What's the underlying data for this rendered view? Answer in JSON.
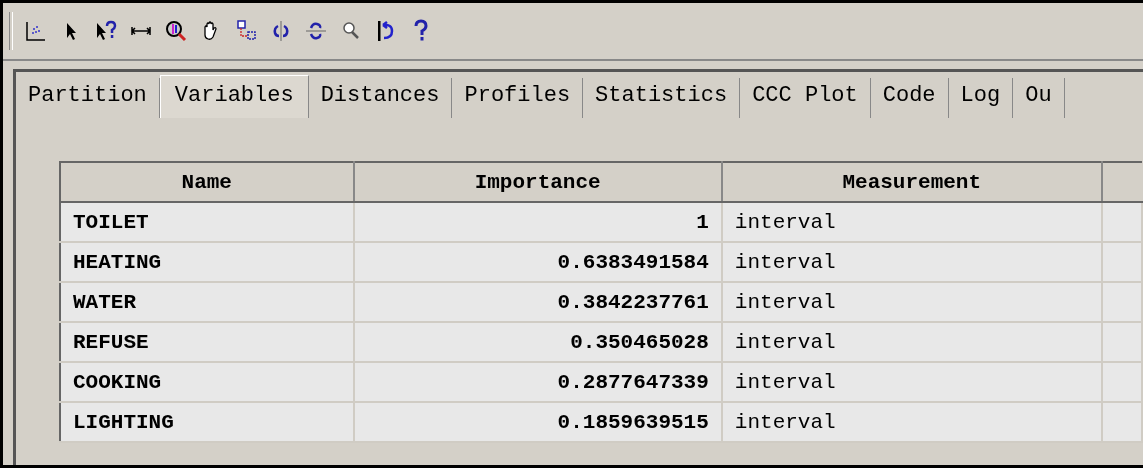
{
  "toolbar": {
    "icons": [
      {
        "kind": "scatter"
      },
      {
        "kind": "arrow"
      },
      {
        "kind": "help-arrow"
      },
      {
        "kind": "resize"
      },
      {
        "kind": "zoom-color"
      },
      {
        "kind": "hand"
      },
      {
        "kind": "link"
      },
      {
        "kind": "rotate-h"
      },
      {
        "kind": "rotate-v"
      },
      {
        "kind": "magnifier"
      },
      {
        "kind": "undo"
      },
      {
        "kind": "help"
      }
    ]
  },
  "tabs": [
    {
      "label": "Partition",
      "selected": false
    },
    {
      "label": "Variables",
      "selected": true
    },
    {
      "label": "Distances",
      "selected": false
    },
    {
      "label": "Profiles",
      "selected": false
    },
    {
      "label": "Statistics",
      "selected": false
    },
    {
      "label": "CCC Plot",
      "selected": false
    },
    {
      "label": "Code",
      "selected": false
    },
    {
      "label": "Log",
      "selected": false
    },
    {
      "label": "Ou",
      "selected": false
    }
  ],
  "table": {
    "columns": [
      "Name",
      "Importance",
      "Measurement"
    ],
    "rows": [
      {
        "name": "TOILET",
        "importance": "1",
        "measurement": "interval"
      },
      {
        "name": "HEATING",
        "importance": "0.6383491584",
        "measurement": "interval"
      },
      {
        "name": "WATER",
        "importance": "0.3842237761",
        "measurement": "interval"
      },
      {
        "name": "REFUSE",
        "importance": "0.350465028",
        "measurement": "interval"
      },
      {
        "name": "COOKING",
        "importance": "0.2877647339",
        "measurement": "interval"
      },
      {
        "name": "LIGHTING",
        "importance": "0.1859639515",
        "measurement": "interval"
      }
    ]
  }
}
